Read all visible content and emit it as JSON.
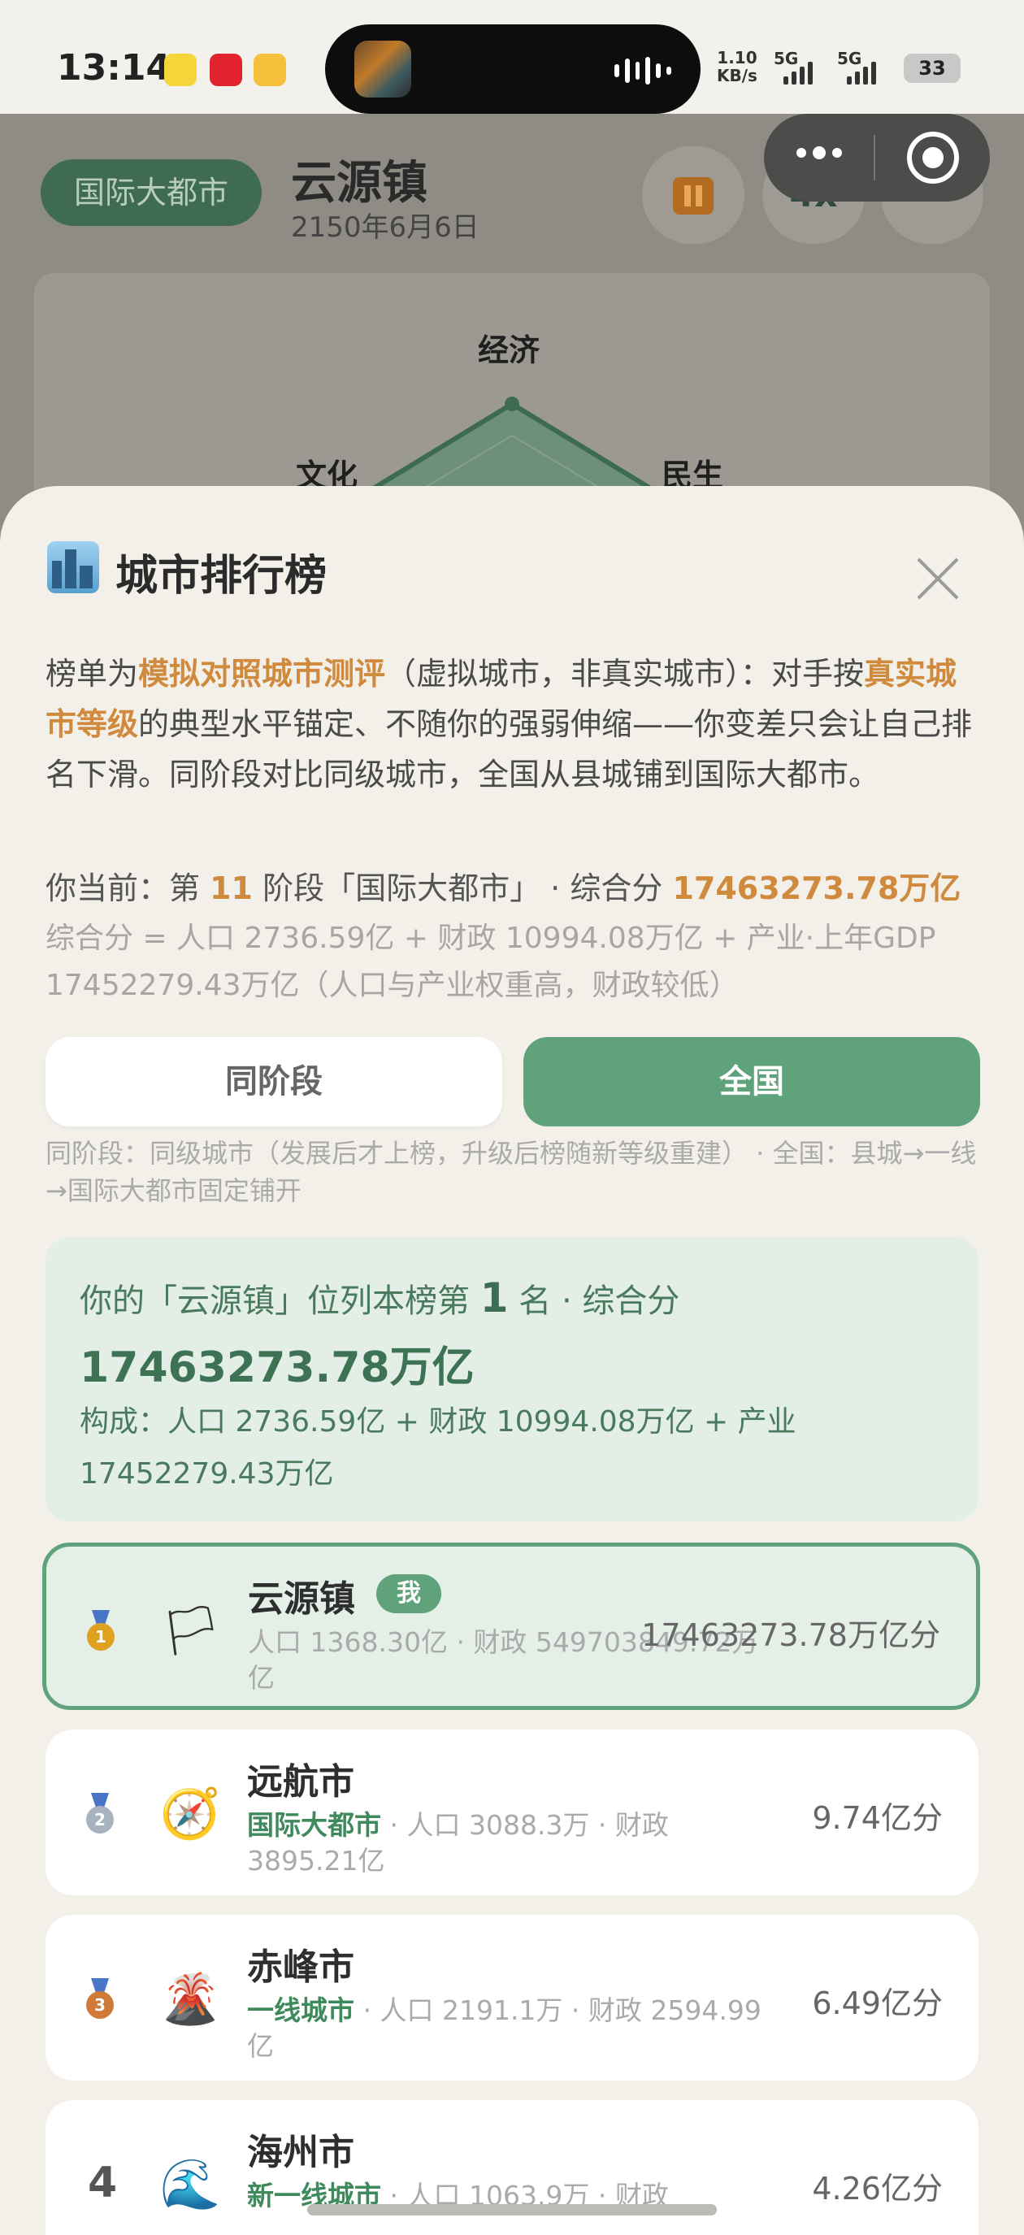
{
  "status_bar": {
    "time": "13:14",
    "net_speed": "1.10",
    "net_unit": "KB/s",
    "sig1": "5G",
    "sig2": "5G",
    "battery": "33"
  },
  "header": {
    "level": "国际大都市",
    "city": "云源镇",
    "date": "2150年6月6日",
    "speed": "4x"
  },
  "radar": {
    "axes": [
      "经济",
      "文化",
      "民生"
    ]
  },
  "sheet": {
    "title": "城市排行榜",
    "intro": {
      "p1": "榜单为",
      "h1": "模拟对照城市测评",
      "p2": "（虚拟城市，非真实城市）：对手按",
      "h2": "真实城市等级",
      "p3": "的典型水平锚定、不随你的强弱伸缩——你变差只会让自己排名下滑。同阶段对比同级城市，全国从县城铺到国际大都市。"
    },
    "current": {
      "prefix": "你当前：第",
      "stage": "11",
      "middle": "阶段「国际大都市」 · 综合分",
      "score": "17463273.78万亿"
    },
    "formula": "综合分 = 人口 2736.59亿 + 财政 10994.08万亿 + 产业·上年GDP 17452279.43万亿（人口与产业权重高，财政较低）",
    "tabs": {
      "same_stage": "同阶段",
      "national": "全国"
    },
    "tab_note": "同阶段：同级城市（发展后才上榜，升级后榜随新等级重建） · 全国：县城→一线→国际大都市固定铺开",
    "summary": {
      "prefix": "你的「云源镇」位列本榜第",
      "rank": "1",
      "suffix": "名 · 综合分",
      "score": "17463273.78万亿",
      "composition": "构成：人口 2736.59亿 + 财政 10994.08万亿 + 产业 17452279.43万亿"
    }
  },
  "rankings": [
    {
      "rank": "1",
      "medal_color": "#e0a020",
      "avatar_icon": "flag-icon",
      "avatar": "🏳",
      "name": "云源镇",
      "me_badge": "我",
      "tier": "",
      "detail": "人口 1368.30亿 · 财政 549703849.72万亿",
      "score": "17463273.78万亿分"
    },
    {
      "rank": "2",
      "medal_color": "#a9b3bf",
      "avatar_icon": "compass-icon",
      "avatar": "🧭",
      "name": "远航市",
      "tier": "国际大都市",
      "detail": " · 人口 3088.3万 · 财政 3895.21亿",
      "score": "9.74亿分"
    },
    {
      "rank": "3",
      "medal_color": "#d07a3a",
      "avatar_icon": "volcano-icon",
      "avatar": "🌋",
      "name": "赤峰市",
      "tier": "一线城市",
      "detail": " · 人口 2191.1万 · 财政 2594.99亿",
      "score": "6.49亿分"
    },
    {
      "rank": "4",
      "avatar_icon": "wave-icon",
      "avatar": "🌊",
      "name": "海州市",
      "tier": "新一线城市",
      "detail": " · 人口 1063.9万 · 财政",
      "score": "4.26亿分"
    }
  ]
}
